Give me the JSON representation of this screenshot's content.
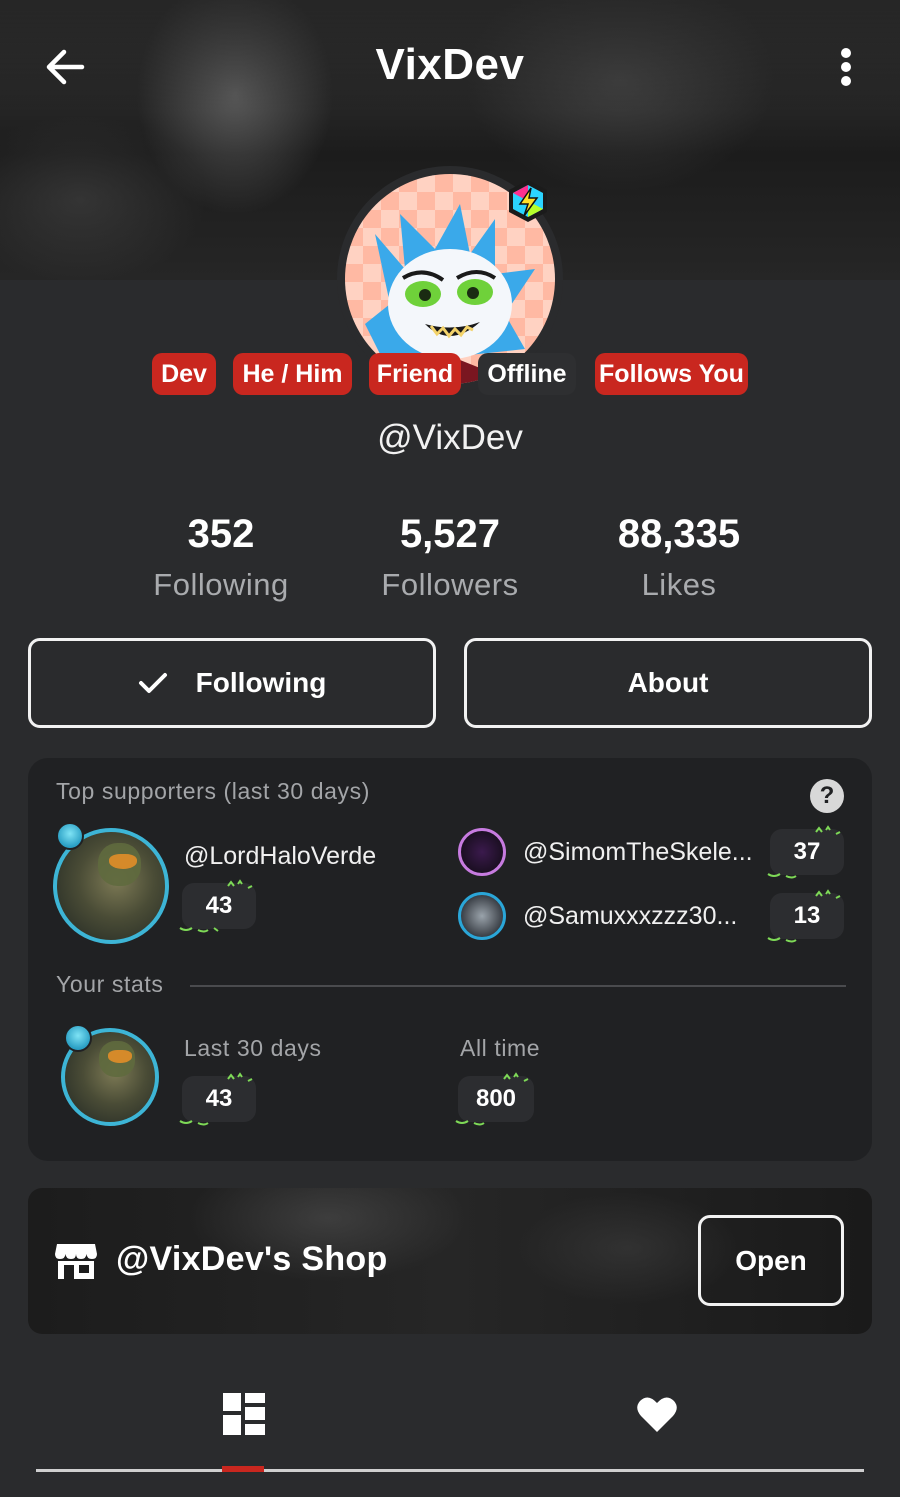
{
  "header": {
    "title": "VixDev",
    "back_icon": "arrow-left-icon",
    "more_icon": "vertical-dots-icon"
  },
  "profile": {
    "tags": [
      "Dev",
      "He / Him",
      "Friend",
      "Offline",
      "Follows You"
    ],
    "handle": "@VixDev"
  },
  "stats": [
    {
      "value": "352",
      "label": "Following"
    },
    {
      "value": "5,527",
      "label": "Followers"
    },
    {
      "value": "88,335",
      "label": "Likes"
    }
  ],
  "actions": {
    "following_label": "Following",
    "about_label": "About"
  },
  "supporters": {
    "title": "Top supporters (last 30 days)",
    "help_glyph": "?",
    "top": {
      "name": "@LordHaloVerde",
      "count": "43"
    },
    "others": [
      {
        "name": "@SimomTheSkele...",
        "count": "37"
      },
      {
        "name": "@Samuxxxzzz30...",
        "count": "13"
      }
    ],
    "your_stats": {
      "title": "Your stats",
      "last30_label": "Last 30 days",
      "last30_value": "43",
      "alltime_label": "All time",
      "alltime_value": "800"
    }
  },
  "shop": {
    "title": "@VixDev's Shop",
    "open_label": "Open"
  },
  "tabs": {
    "active": "posts",
    "items": [
      "grid-icon",
      "heart-icon"
    ]
  },
  "colors": {
    "background": "#2a2b2d",
    "card": "#202123",
    "accent_red": "#c9271f",
    "muted_text": "#a3a5a8"
  }
}
